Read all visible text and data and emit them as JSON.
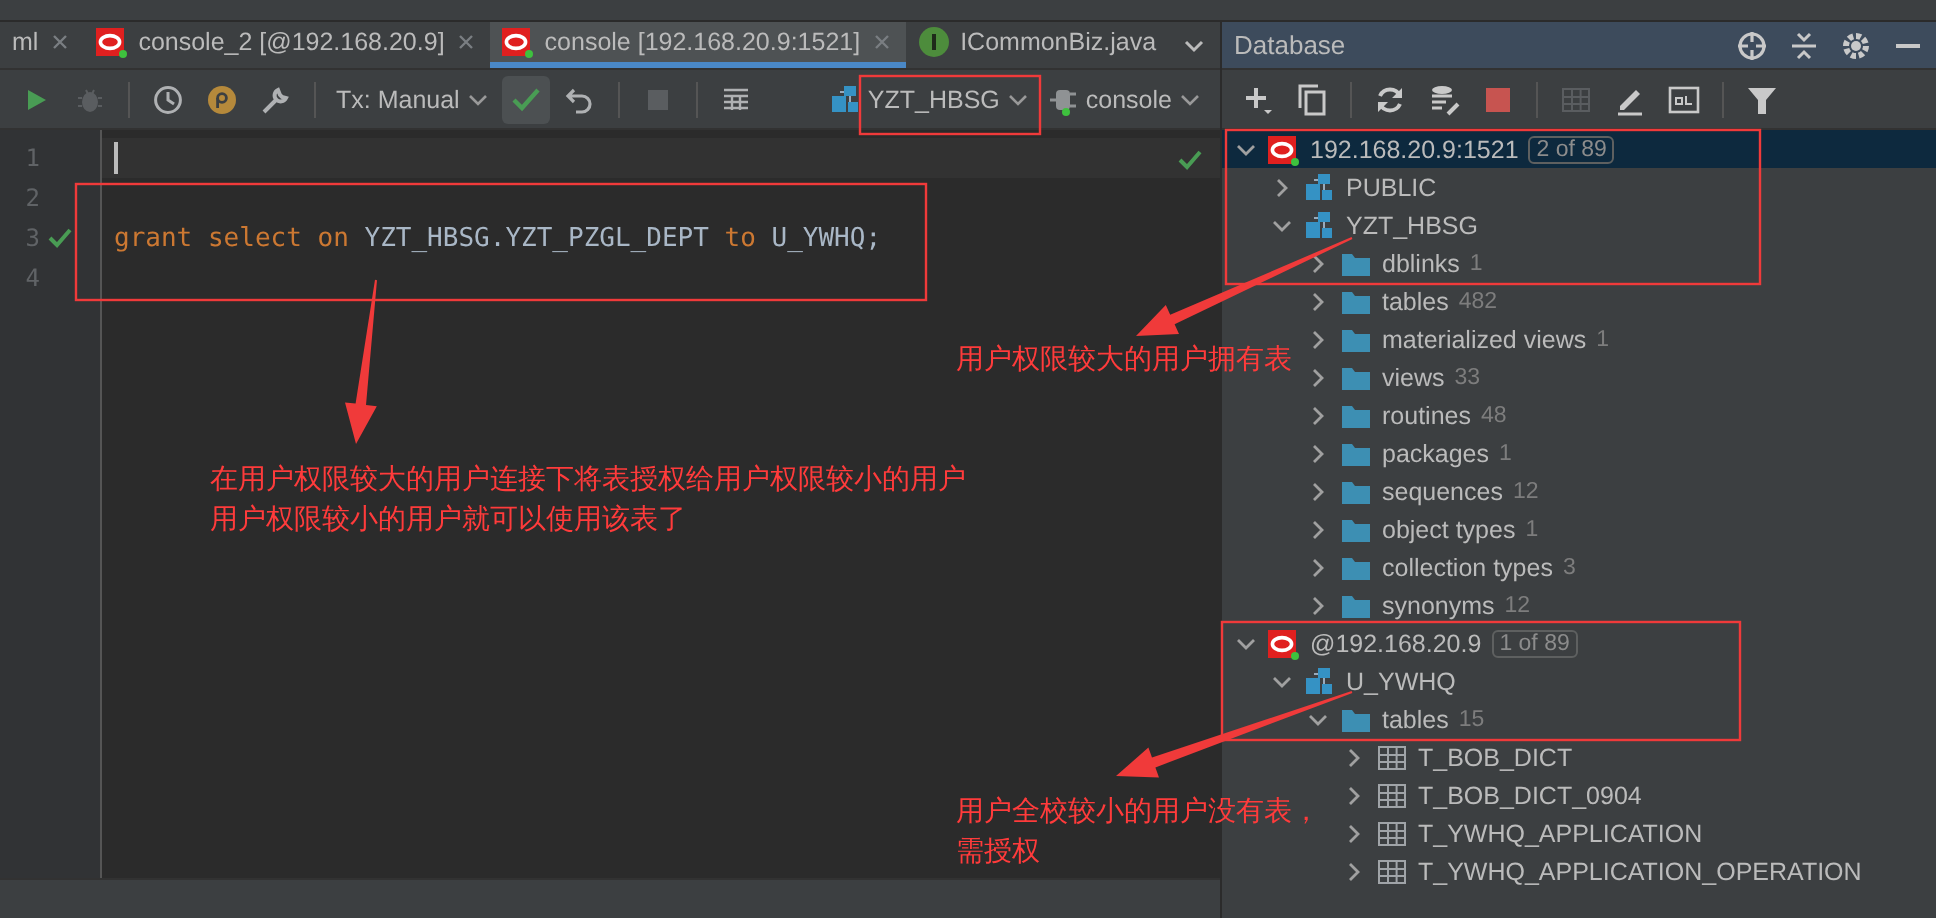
{
  "editor_tabs": [
    {
      "label": "ml",
      "kind": "file",
      "selected": false
    },
    {
      "label": "console_2 [@192.168.20.9]",
      "kind": "console",
      "selected": false
    },
    {
      "label": "console [192.168.20.9:1521]",
      "kind": "console",
      "selected": true
    },
    {
      "label": "ICommonBiz.java",
      "kind": "class",
      "selected": false
    }
  ],
  "toolbar": {
    "transaction_mode": "Tx: Manual",
    "schema": "YZT_HBSG",
    "session": "console"
  },
  "editor": {
    "lines": [
      {
        "number": "1",
        "current": true,
        "ok": false
      },
      {
        "number": "2",
        "current": false,
        "ok": false
      },
      {
        "number": "3",
        "current": false,
        "ok": true,
        "tokens": [
          {
            "kind": "keyword",
            "text": "grant"
          },
          {
            "kind": "keyword",
            "text": "select"
          },
          {
            "kind": "keyword",
            "text": "on"
          },
          {
            "kind": "identifier",
            "text": "YZT_HBSG.YZT_PZGL_DEPT"
          },
          {
            "kind": "keyword",
            "text": "to"
          },
          {
            "kind": "identifier",
            "text": "U_YWHQ;"
          }
        ]
      },
      {
        "number": "4",
        "current": false,
        "ok": false
      }
    ]
  },
  "database_panel": {
    "title": "Database",
    "tree": [
      {
        "kind": "connection",
        "label": "192.168.20.9:1521",
        "badge": "2 of 89",
        "expanded": true,
        "selected": true,
        "children": [
          {
            "kind": "schema",
            "label": "PUBLIC",
            "expanded": false,
            "selected": false
          },
          {
            "kind": "schema",
            "label": "YZT_HBSG",
            "expanded": true,
            "selected": false,
            "children": [
              {
                "kind": "folder",
                "label": "dblinks",
                "count": "1",
                "expanded": false,
                "selected": false
              },
              {
                "kind": "folder",
                "label": "tables",
                "count": "482",
                "expanded": false,
                "selected": false
              },
              {
                "kind": "folder",
                "label": "materialized views",
                "count": "1",
                "expanded": false,
                "selected": false
              },
              {
                "kind": "folder",
                "label": "views",
                "count": "33",
                "expanded": false,
                "selected": false
              },
              {
                "kind": "folder",
                "label": "routines",
                "count": "48",
                "expanded": false,
                "selected": false
              },
              {
                "kind": "folder",
                "label": "packages",
                "count": "1",
                "expanded": false,
                "selected": false
              },
              {
                "kind": "folder",
                "label": "sequences",
                "count": "12",
                "expanded": false,
                "selected": false
              },
              {
                "kind": "folder",
                "label": "object types",
                "count": "1",
                "expanded": false,
                "selected": false
              },
              {
                "kind": "folder",
                "label": "collection types",
                "count": "3",
                "expanded": false,
                "selected": false
              },
              {
                "kind": "folder",
                "label": "synonyms",
                "count": "12",
                "expanded": false,
                "selected": false
              }
            ]
          }
        ]
      },
      {
        "kind": "connection",
        "label": "@192.168.20.9",
        "badge": "1 of 89",
        "expanded": true,
        "selected": false,
        "children": [
          {
            "kind": "schema",
            "label": "U_YWHQ",
            "expanded": true,
            "selected": false,
            "children": [
              {
                "kind": "folder",
                "label": "tables",
                "count": "15",
                "expanded": true,
                "selected": false,
                "children": [
                  {
                    "kind": "table",
                    "label": "T_BOB_DICT",
                    "expanded": false,
                    "selected": false
                  },
                  {
                    "kind": "table",
                    "label": "T_BOB_DICT_0904",
                    "expanded": false,
                    "selected": false
                  },
                  {
                    "kind": "table",
                    "label": "T_YWHQ_APPLICATION",
                    "expanded": false,
                    "selected": false
                  },
                  {
                    "kind": "table",
                    "label": "T_YWHQ_APPLICATION_OPERATION",
                    "expanded": false,
                    "selected": false
                  }
                ]
              }
            ]
          }
        ]
      }
    ]
  },
  "annotations": [
    {
      "lines": [
        "用户权限较大的用户拥有表"
      ]
    },
    {
      "lines": [
        "在用户权限较大的用户连接下将表授权给用户权限较小的用户",
        "用户权限较小的用户就可以使用该表了"
      ]
    },
    {
      "lines": [
        "用户全校较小的用户没有表，",
        "需授权"
      ]
    }
  ]
}
